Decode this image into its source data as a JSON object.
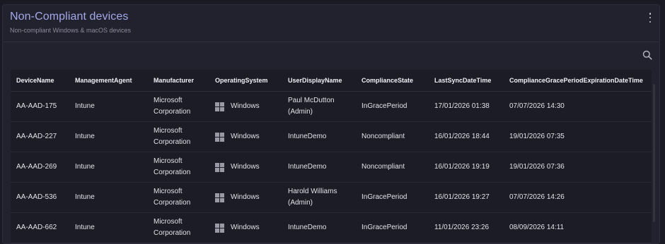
{
  "widget": {
    "title": "Non-Compliant devices",
    "subtitle": "Non-compliant Windows & macOS devices"
  },
  "table": {
    "columns": [
      "DeviceName",
      "ManagementAgent",
      "Manufacturer",
      "OperatingSystem",
      "UserDisplayName",
      "ComplianceState",
      "LastSyncDateTime",
      "ComplianceGracePeriodExpirationDateTime"
    ],
    "rows": [
      {
        "device": "AA-AAD-175",
        "agent": "Intune",
        "manufacturer": "Microsoft Corporation",
        "os": "Windows",
        "user": "Paul McDutton (Admin)",
        "state": "InGracePeriod",
        "last_sync": "17/01/2026 01:38",
        "grace": "07/07/2026 14:30"
      },
      {
        "device": "AA-AAD-227",
        "agent": "Intune",
        "manufacturer": "Microsoft Corporation",
        "os": "Windows",
        "user": "IntuneDemo",
        "state": "Noncompliant",
        "last_sync": "16/01/2026 18:44",
        "grace": "19/01/2026 07:35"
      },
      {
        "device": "AA-AAD-269",
        "agent": "Intune",
        "manufacturer": "Microsoft Corporation",
        "os": "Windows",
        "user": "IntuneDemo",
        "state": "Noncompliant",
        "last_sync": "16/01/2026 19:19",
        "grace": "19/01/2026 07:36"
      },
      {
        "device": "AA-AAD-536",
        "agent": "Intune",
        "manufacturer": "Microsoft Corporation",
        "os": "Windows",
        "user": "Harold Williams (Admin)",
        "state": "InGracePeriod",
        "last_sync": "16/01/2026 19:27",
        "grace": "07/07/2026 14:26"
      },
      {
        "device": "AA-AAD-662",
        "agent": "Intune",
        "manufacturer": "Microsoft Corporation",
        "os": "Windows",
        "user": "IntuneDemo",
        "state": "InGracePeriod",
        "last_sync": "11/01/2026 23:26",
        "grace": "08/09/2026 14:11"
      }
    ]
  },
  "icons": {
    "menu": "more-vertical-icon",
    "search": "search-icon",
    "os": "windows-icon"
  },
  "colors": {
    "background": "#1a1a24",
    "card": "#22222e",
    "title": "#a3a8e8"
  }
}
